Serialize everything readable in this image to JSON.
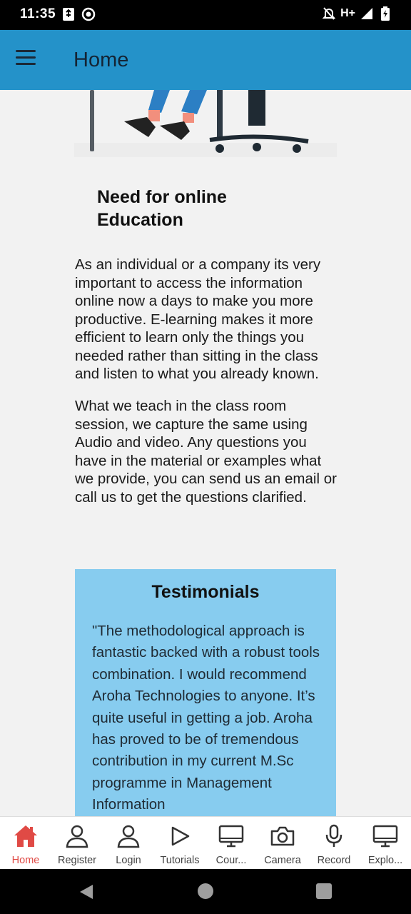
{
  "status_bar": {
    "time": "11:35",
    "network_label": "H+",
    "icons": [
      "usb-icon",
      "sync-icon",
      "mute-icon",
      "signal-icon",
      "battery-charging-icon"
    ]
  },
  "app_bar": {
    "title": "Home",
    "menu_icon": "hamburger-menu-icon"
  },
  "content": {
    "section_title": "Need for online Education",
    "paragraphs": [
      "As an individual or a company its very important to access the information online now a days to make you more productive. E-learning makes it more efficient to learn only the things you needed rather than sitting in the class and listen to what you already known.",
      "What we teach in the class room session, we capture the same using Audio and video. Any questions you have in the material or examples what we provide, you can send us an email or call us to get the questions clarified."
    ],
    "testimonials": {
      "title": "Testimonials",
      "quote": "\"The methodological approach is fantastic backed with a robust tools combination. I would recommend Aroha Technologies to anyone. It’s quite useful in getting a job. Aroha has proved to be of tremendous contribution in my current M.Sc programme in Management Information"
    }
  },
  "bottom_nav": {
    "items": [
      {
        "label": "Home",
        "icon": "home-icon",
        "active": true
      },
      {
        "label": "Register",
        "icon": "person-icon",
        "active": false
      },
      {
        "label": "Login",
        "icon": "person-icon",
        "active": false
      },
      {
        "label": "Tutorials",
        "icon": "play-icon",
        "active": false
      },
      {
        "label": "Cour...",
        "icon": "monitor-icon",
        "active": false
      },
      {
        "label": "Camera",
        "icon": "camera-icon",
        "active": false
      },
      {
        "label": "Record",
        "icon": "microphone-icon",
        "active": false
      },
      {
        "label": "Explo...",
        "icon": "monitor-icon",
        "active": false
      }
    ]
  },
  "colors": {
    "app_bar": "#2492c9",
    "testimonial_bg": "#87ccef",
    "active_nav": "#e04a45"
  }
}
